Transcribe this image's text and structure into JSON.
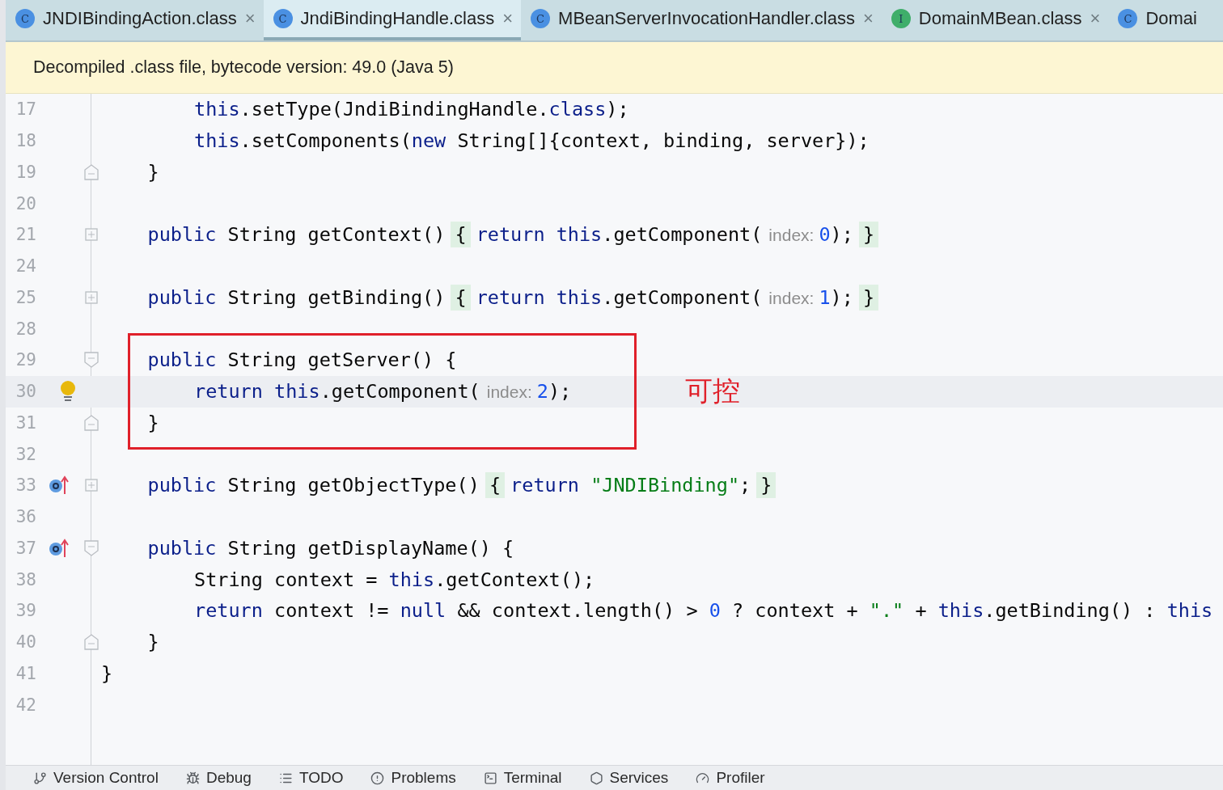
{
  "tabs": [
    {
      "icon_letter": "C",
      "color": "#4a90e2",
      "label": "JNDIBindingAction.class",
      "close": "×",
      "selected": false
    },
    {
      "icon_letter": "C",
      "color": "#4a90e2",
      "label": "JndiBindingHandle.class",
      "close": "×",
      "selected": true
    },
    {
      "icon_letter": "C",
      "color": "#4a90e2",
      "label": "MBeanServerInvocationHandler.class",
      "close": "×",
      "selected": false
    },
    {
      "icon_letter": "I",
      "color": "#3fae6a",
      "label": "DomainMBean.class",
      "close": "×",
      "selected": false
    },
    {
      "icon_letter": "C",
      "color": "#4a90e2",
      "label": "Domai",
      "selected": false
    }
  ],
  "banner": "Decompiled .class file, bytecode version: 49.0 (Java 5)",
  "annotation": "可控",
  "lines": [
    {
      "children": [
        {
          "children": [
            {
              "number": "17",
              "tokens": [
                {
                  "kind": "keyword",
                  "text": "this"
                },
                {
                  "kind": "plain",
                  "text": ".setType(JndiBindingHandle."
                },
                {
                  "kind": "keyword",
                  "text": "class"
                },
                {
                  "kind": "plain",
                  "text": ");"
                }
              ]
            },
            {
              "number": "18",
              "tokens": [
                {
                  "kind": "keyword",
                  "text": "this"
                },
                {
                  "kind": "plain",
                  "text": ".setComponents("
                },
                {
                  "kind": "keyword",
                  "text": "new"
                },
                {
                  "kind": "plain",
                  "text": " String[]{context, binding, server});"
                }
              ]
            }
          ]
        },
        {
          "number": "19",
          "fold_end": true,
          "tokens": [
            {
              "kind": "plain",
              "text": "}"
            }
          ]
        },
        {
          "number": "20"
        },
        {
          "number": "21",
          "collapsed": true,
          "tokens": [
            {
              "kind": "keyword",
              "text": "public"
            },
            {
              "kind": "plain",
              "text": " String getContext()"
            },
            {
              "kind": "fold",
              "text": "{"
            },
            {
              "kind": "keyword",
              "text": "return this"
            },
            {
              "kind": "plain",
              "text": ".getComponent("
            },
            {
              "kind": "hint",
              "text": "index:"
            },
            {
              "kind": "number",
              "text": "0"
            },
            {
              "kind": "plain",
              "text": ");"
            },
            {
              "kind": "fold",
              "text": "}"
            }
          ]
        },
        {
          "number": "24"
        },
        {
          "number": "25",
          "collapsed": true,
          "tokens": [
            {
              "kind": "keyword",
              "text": "public"
            },
            {
              "kind": "plain",
              "text": " String getBinding()"
            },
            {
              "kind": "fold",
              "text": "{"
            },
            {
              "kind": "keyword",
              "text": "return this"
            },
            {
              "kind": "plain",
              "text": ".getComponent("
            },
            {
              "kind": "hint",
              "text": "index:"
            },
            {
              "kind": "number",
              "text": "1"
            },
            {
              "kind": "plain",
              "text": ");"
            },
            {
              "kind": "fold",
              "text": "}"
            }
          ]
        },
        {
          "number": "28"
        },
        {
          "number": "29",
          "fold_start": true,
          "boxed": true,
          "tokens": [
            {
              "kind": "keyword",
              "text": "public"
            },
            {
              "kind": "plain",
              "text": " String getServer() {"
            }
          ],
          "children": [
            {
              "number": "30",
              "boxed": true,
              "highlighted": true,
              "intention": true,
              "tokens": [
                {
                  "kind": "keyword",
                  "text": "return this"
                },
                {
                  "kind": "plain",
                  "text": ".getComponent("
                },
                {
                  "kind": "hint",
                  "text": "index:"
                },
                {
                  "kind": "number",
                  "text": "2"
                },
                {
                  "kind": "plain",
                  "text": ");"
                }
              ]
            }
          ]
        },
        {
          "number": "31",
          "fold_end": true,
          "boxed": true,
          "tokens": [
            {
              "kind": "plain",
              "text": "}"
            }
          ]
        },
        {
          "number": "32"
        },
        {
          "number": "33",
          "collapsed": true,
          "overrides": true,
          "tokens": [
            {
              "kind": "keyword",
              "text": "public"
            },
            {
              "kind": "plain",
              "text": " String getObjectType()"
            },
            {
              "kind": "fold",
              "text": "{"
            },
            {
              "kind": "keyword",
              "text": "return "
            },
            {
              "kind": "string",
              "text": "\"JNDIBinding\""
            },
            {
              "kind": "plain",
              "text": ";"
            },
            {
              "kind": "fold",
              "text": "}"
            }
          ]
        },
        {
          "number": "36"
        },
        {
          "number": "37",
          "fold_start": true,
          "overrides": true,
          "tokens": [
            {
              "kind": "keyword",
              "text": "public"
            },
            {
              "kind": "plain",
              "text": " String getDisplayName() {"
            }
          ],
          "children": [
            {
              "number": "38",
              "tokens": [
                {
                  "kind": "plain",
                  "text": "String context = "
                },
                {
                  "kind": "keyword",
                  "text": "this"
                },
                {
                  "kind": "plain",
                  "text": ".getContext();"
                }
              ]
            },
            {
              "number": "39",
              "tokens": [
                {
                  "kind": "keyword",
                  "text": "return"
                },
                {
                  "kind": "plain",
                  "text": " context != "
                },
                {
                  "kind": "keyword",
                  "text": "null"
                },
                {
                  "kind": "plain",
                  "text": " && context.length() > "
                },
                {
                  "kind": "number",
                  "text": "0"
                },
                {
                  "kind": "plain",
                  "text": " ? context + "
                },
                {
                  "kind": "string",
                  "text": "\".\""
                },
                {
                  "kind": "plain",
                  "text": " + "
                },
                {
                  "kind": "keyword",
                  "text": "this"
                },
                {
                  "kind": "plain",
                  "text": ".getBinding() : "
                },
                {
                  "kind": "keyword",
                  "text": "this"
                }
              ]
            }
          ]
        },
        {
          "number": "40",
          "fold_end": true,
          "tokens": [
            {
              "kind": "plain",
              "text": "}"
            }
          ]
        }
      ]
    },
    {
      "number": "41",
      "tokens": [
        {
          "kind": "plain",
          "text": "}"
        }
      ]
    },
    {
      "number": "42"
    }
  ],
  "tool_windows": [
    {
      "label": "Version Control"
    },
    {
      "label": "Debug"
    },
    {
      "label": "TODO"
    },
    {
      "label": "Problems"
    },
    {
      "label": "Terminal"
    },
    {
      "label": "Services"
    },
    {
      "label": "Profiler"
    }
  ]
}
